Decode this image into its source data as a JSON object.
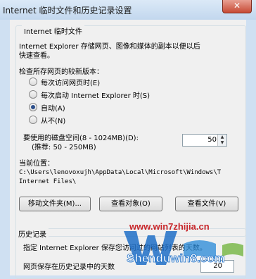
{
  "window": {
    "title": "Internet 临时文件和历史记录设置",
    "close_glyph": "✕"
  },
  "temp_files": {
    "group_title": "Internet 临时文件",
    "description_line1": "Internet Explorer 存储网页、图像和媒体的副本以便以后",
    "description_line2": "快速查看。",
    "check_label": "检查所存网页的较新版本：",
    "options": [
      {
        "label": "每次访问网页时(E)",
        "checked": false
      },
      {
        "label": "每次启动 Internet Explorer 时(S)",
        "checked": false
      },
      {
        "label": "自动(A)",
        "checked": true
      },
      {
        "label": "从不(N)",
        "checked": false
      }
    ],
    "disk_label_line1": "要使用的磁盘空间(8 - 1024MB)(D):",
    "disk_label_line2": "(推荐: 50 - 250MB)",
    "disk_value": "50",
    "location_label": "当前位置：",
    "location_path_line1": "C:\\Users\\lenovoxujh\\AppData\\Local\\Microsoft\\Windows\\T",
    "location_path_line2": "Internet Files\\",
    "buttons": {
      "move": "移动文件夹(M)...",
      "view_objects": "查看对象(O)",
      "view_files": "查看文件(V)"
    }
  },
  "history": {
    "group_title": "历史记录",
    "description": "指定 Internet Explorer 保存您访问过的网站列表的天数。",
    "days_label": "网页保存在历史记录中的天数",
    "days_value": "20"
  },
  "watermarks": {
    "site1": "www.win7zhijia.cn",
    "logo_text": "Shenduwin8.com"
  },
  "colors": {
    "close_red": "#c74a34",
    "watermark_red": "#c8262a",
    "watermark_blue": "#1e6fc7"
  }
}
